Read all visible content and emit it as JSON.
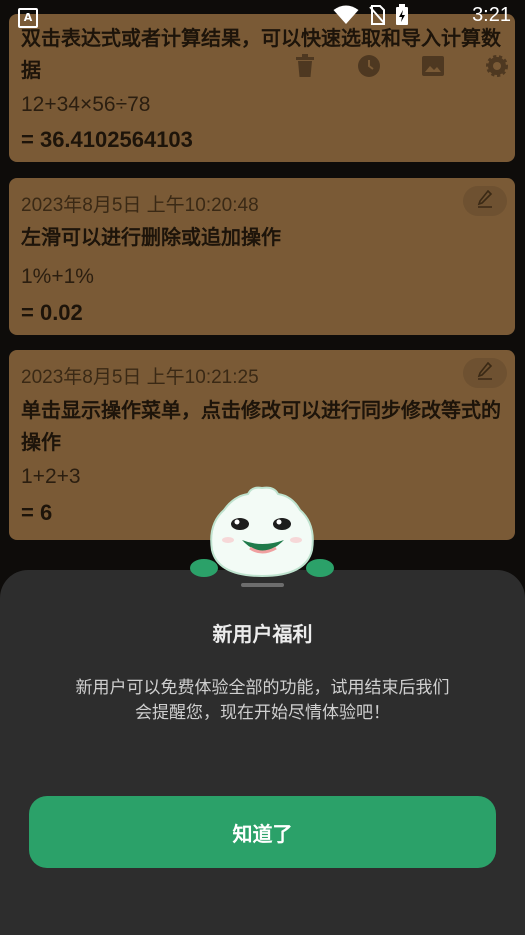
{
  "status_bar": {
    "app_indicator": "A",
    "time": "3:21",
    "icons": [
      "wifi-icon",
      "no-sim-icon",
      "battery-charging-icon"
    ]
  },
  "toolbar": {
    "icons": [
      "trash-icon",
      "clock-icon",
      "image-icon",
      "settings-icon"
    ]
  },
  "history": [
    {
      "title": "双击表达式或者计算结果，可以快速选取和导入计算数据",
      "expression": "12+34×56÷78",
      "result": "= 36.4102564103"
    },
    {
      "date": "2023年8月5日 上午10:20:48",
      "title": "左滑可以进行删除或追加操作",
      "expression": "1%+1%",
      "result": "= 0.02"
    },
    {
      "date": "2023年8月5日 上午10:21:25",
      "title": "单击显示操作菜单，点击修改可以进行同步修改等式的操作",
      "expression": "1+2+3",
      "result": "= 6"
    }
  ],
  "dialog": {
    "title": "新用户福利",
    "description": "新用户可以免费体验全部的功能，试用结束后我们会提醒您，现在开始尽情体验吧！",
    "confirm_label": "知道了"
  },
  "colors": {
    "card": "#7a5a36",
    "accent": "#2ba169",
    "sheet": "#2d2d2d"
  }
}
